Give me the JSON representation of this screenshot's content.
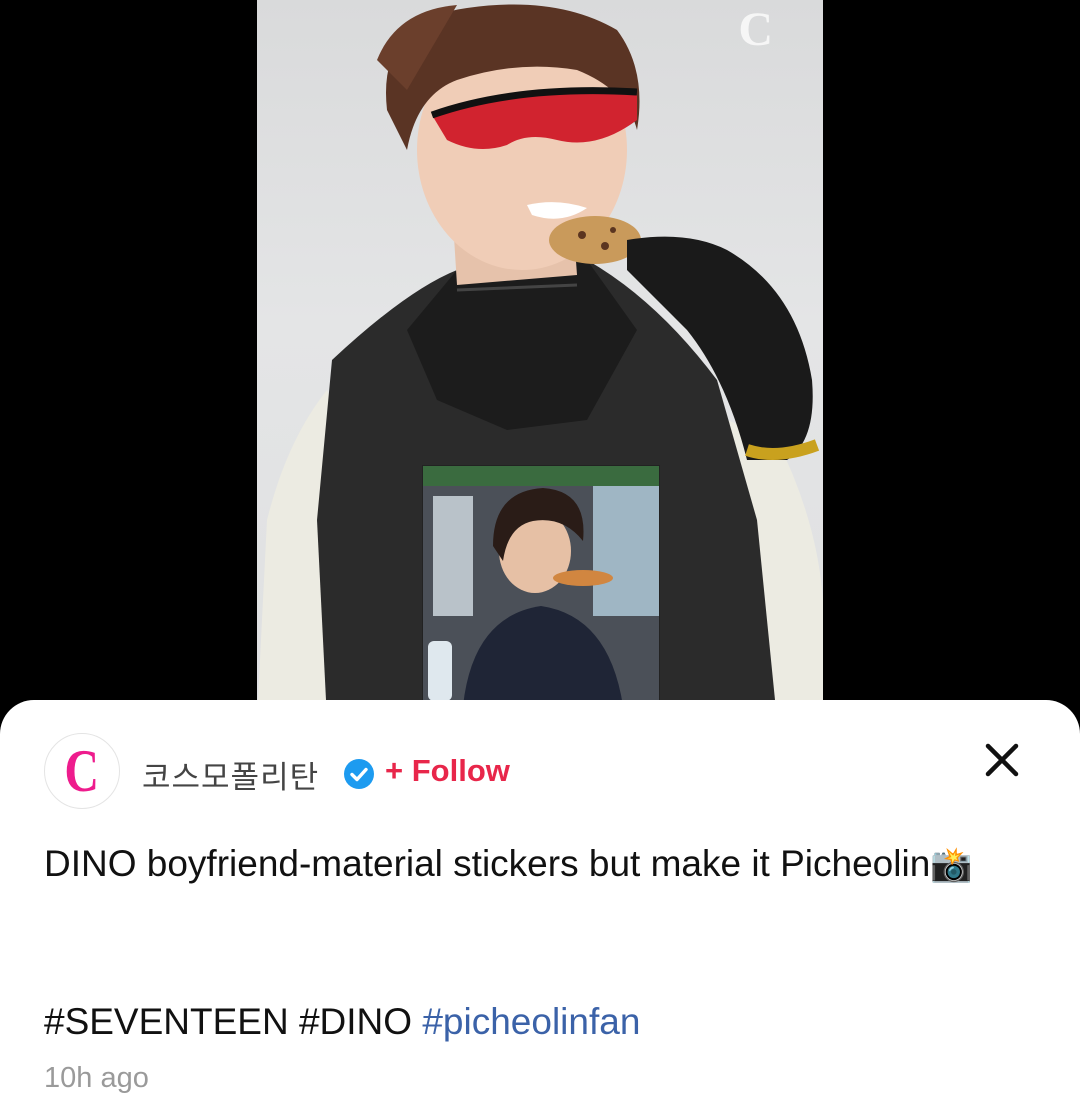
{
  "media": {
    "watermark": "C",
    "accent_color": "#ee1c8d"
  },
  "post": {
    "account": {
      "avatar_letter": "C",
      "name": "코스모폴리탄",
      "verified_icon": "verified-check-icon",
      "follow_label": "+ Follow"
    },
    "close_icon": "close-icon",
    "caption_text": "DINO boyfriend-material stickers but make it Picheolin",
    "caption_emoji": "📸",
    "hashtags": [
      "#SEVENTEEN",
      "#DINO",
      "#picheolinfan"
    ],
    "timestamp": "10h ago"
  },
  "colors": {
    "follow": "#e8264a",
    "hashtag_link": "#3b62a8",
    "verified": "#1d9bf0",
    "brand": "#ee1c8d"
  }
}
